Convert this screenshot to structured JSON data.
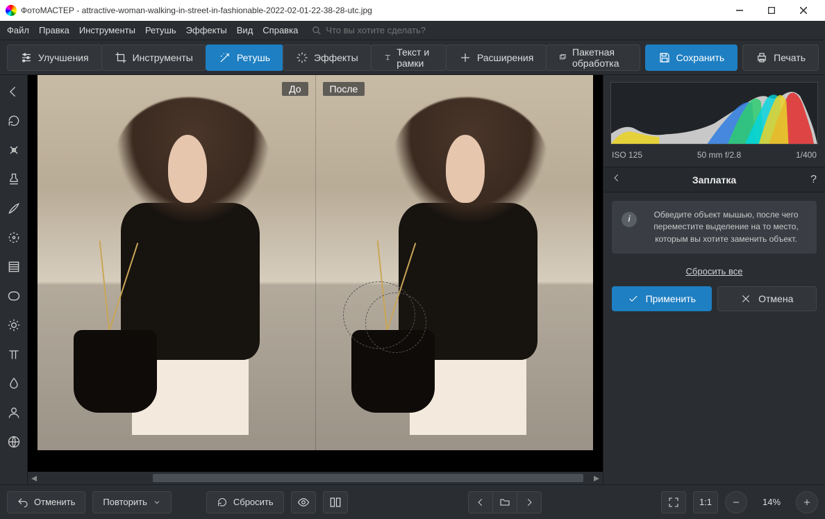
{
  "app": {
    "name": "ФотоМАСТЕР",
    "filename": "attractive-woman-walking-in-street-in-fashionable-2022-02-01-22-38-28-utc.jpg"
  },
  "menu": {
    "file": "Файл",
    "edit": "Правка",
    "tools": "Инструменты",
    "retouch": "Ретушь",
    "effects": "Эффекты",
    "view": "Вид",
    "help": "Справка",
    "search_placeholder": "Что вы хотите сделать?"
  },
  "tabs": {
    "enhance": "Улучшения",
    "tools": "Инструменты",
    "retouch": "Ретушь",
    "effects": "Эффекты",
    "text": "Текст и рамки",
    "extensions": "Расширения",
    "batch": "Пакетная обработка",
    "save": "Сохранить",
    "print": "Печать"
  },
  "viewport": {
    "before": "До",
    "after": "После"
  },
  "exif": {
    "iso": "ISO 125",
    "lens": "50 mm f/2.8",
    "shutter": "1/400"
  },
  "panel": {
    "title": "Заплатка",
    "hint": "Обведите объект мышью, после чего переместите выделение на то место, которым вы хотите заменить объект.",
    "reset": "Сбросить все",
    "apply": "Применить",
    "cancel": "Отмена"
  },
  "bottom": {
    "undo": "Отменить",
    "redo": "Повторить",
    "reset": "Сбросить",
    "ratio": "1:1",
    "zoom": "14%"
  }
}
